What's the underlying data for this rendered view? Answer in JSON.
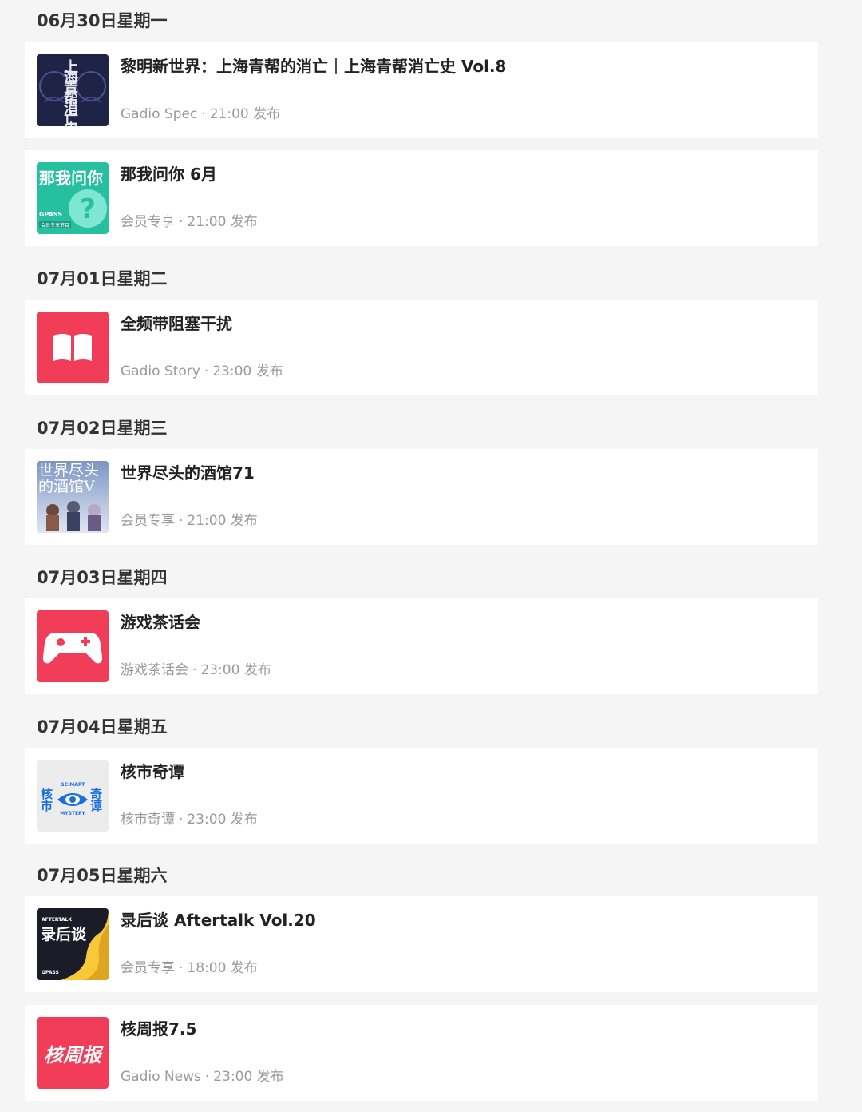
{
  "days": [
    {
      "date": "06月30日星期一",
      "items": [
        {
          "title": "黎明新世界：上海青帮的消亡｜上海青帮消亡史 Vol.8",
          "category": "Gadio Spec",
          "time": "21:00",
          "action": "发布",
          "cover_text": "上海青帮消亡史"
        },
        {
          "title": "那我问你 6月",
          "category": "会员专享",
          "time": "21:00",
          "action": "发布",
          "cover_text": "那我问你",
          "cover_sub": "GPASS",
          "cover_sub2": "会员专享节目"
        }
      ]
    },
    {
      "date": "07月01日星期二",
      "items": [
        {
          "title": "全频带阻塞干扰",
          "category": "Gadio Story",
          "time": "23:00",
          "action": "发布"
        }
      ]
    },
    {
      "date": "07月02日星期三",
      "items": [
        {
          "title": "世界尽头的酒馆71",
          "category": "会员专享",
          "time": "21:00",
          "action": "发布",
          "cover_text": "世界尽头的酒馆V"
        }
      ]
    },
    {
      "date": "07月03日星期四",
      "items": [
        {
          "title": "游戏茶话会",
          "category": "游戏茶话会",
          "time": "23:00",
          "action": "发布"
        }
      ]
    },
    {
      "date": "07月04日星期五",
      "items": [
        {
          "title": "核市奇谭",
          "category": "核市奇谭",
          "time": "23:00",
          "action": "发布",
          "cover_left": "核市",
          "cover_right": "奇谭",
          "cover_top": "GC.MART",
          "cover_bottom": "MYSTERY"
        }
      ]
    },
    {
      "date": "07月05日星期六",
      "items": [
        {
          "title": "录后谈 Aftertalk Vol.20",
          "category": "会员专享",
          "time": "18:00",
          "action": "发布",
          "cover_top": "AFTERTALK",
          "cover_text": "录后谈",
          "cover_sub": "GPASS"
        },
        {
          "title": "核周报7.5",
          "category": "Gadio News",
          "time": "23:00",
          "action": "发布",
          "cover_text": "核周报"
        }
      ]
    }
  ],
  "colors": {
    "accent_red": "#f23d58",
    "teal": "#26c0a1",
    "navy": "#1f2446",
    "blue": "#1a6fe0",
    "yellow": "#f7c838"
  },
  "icons": {
    "story": "open-book-icon",
    "teatalk": "gamepad-icon"
  }
}
